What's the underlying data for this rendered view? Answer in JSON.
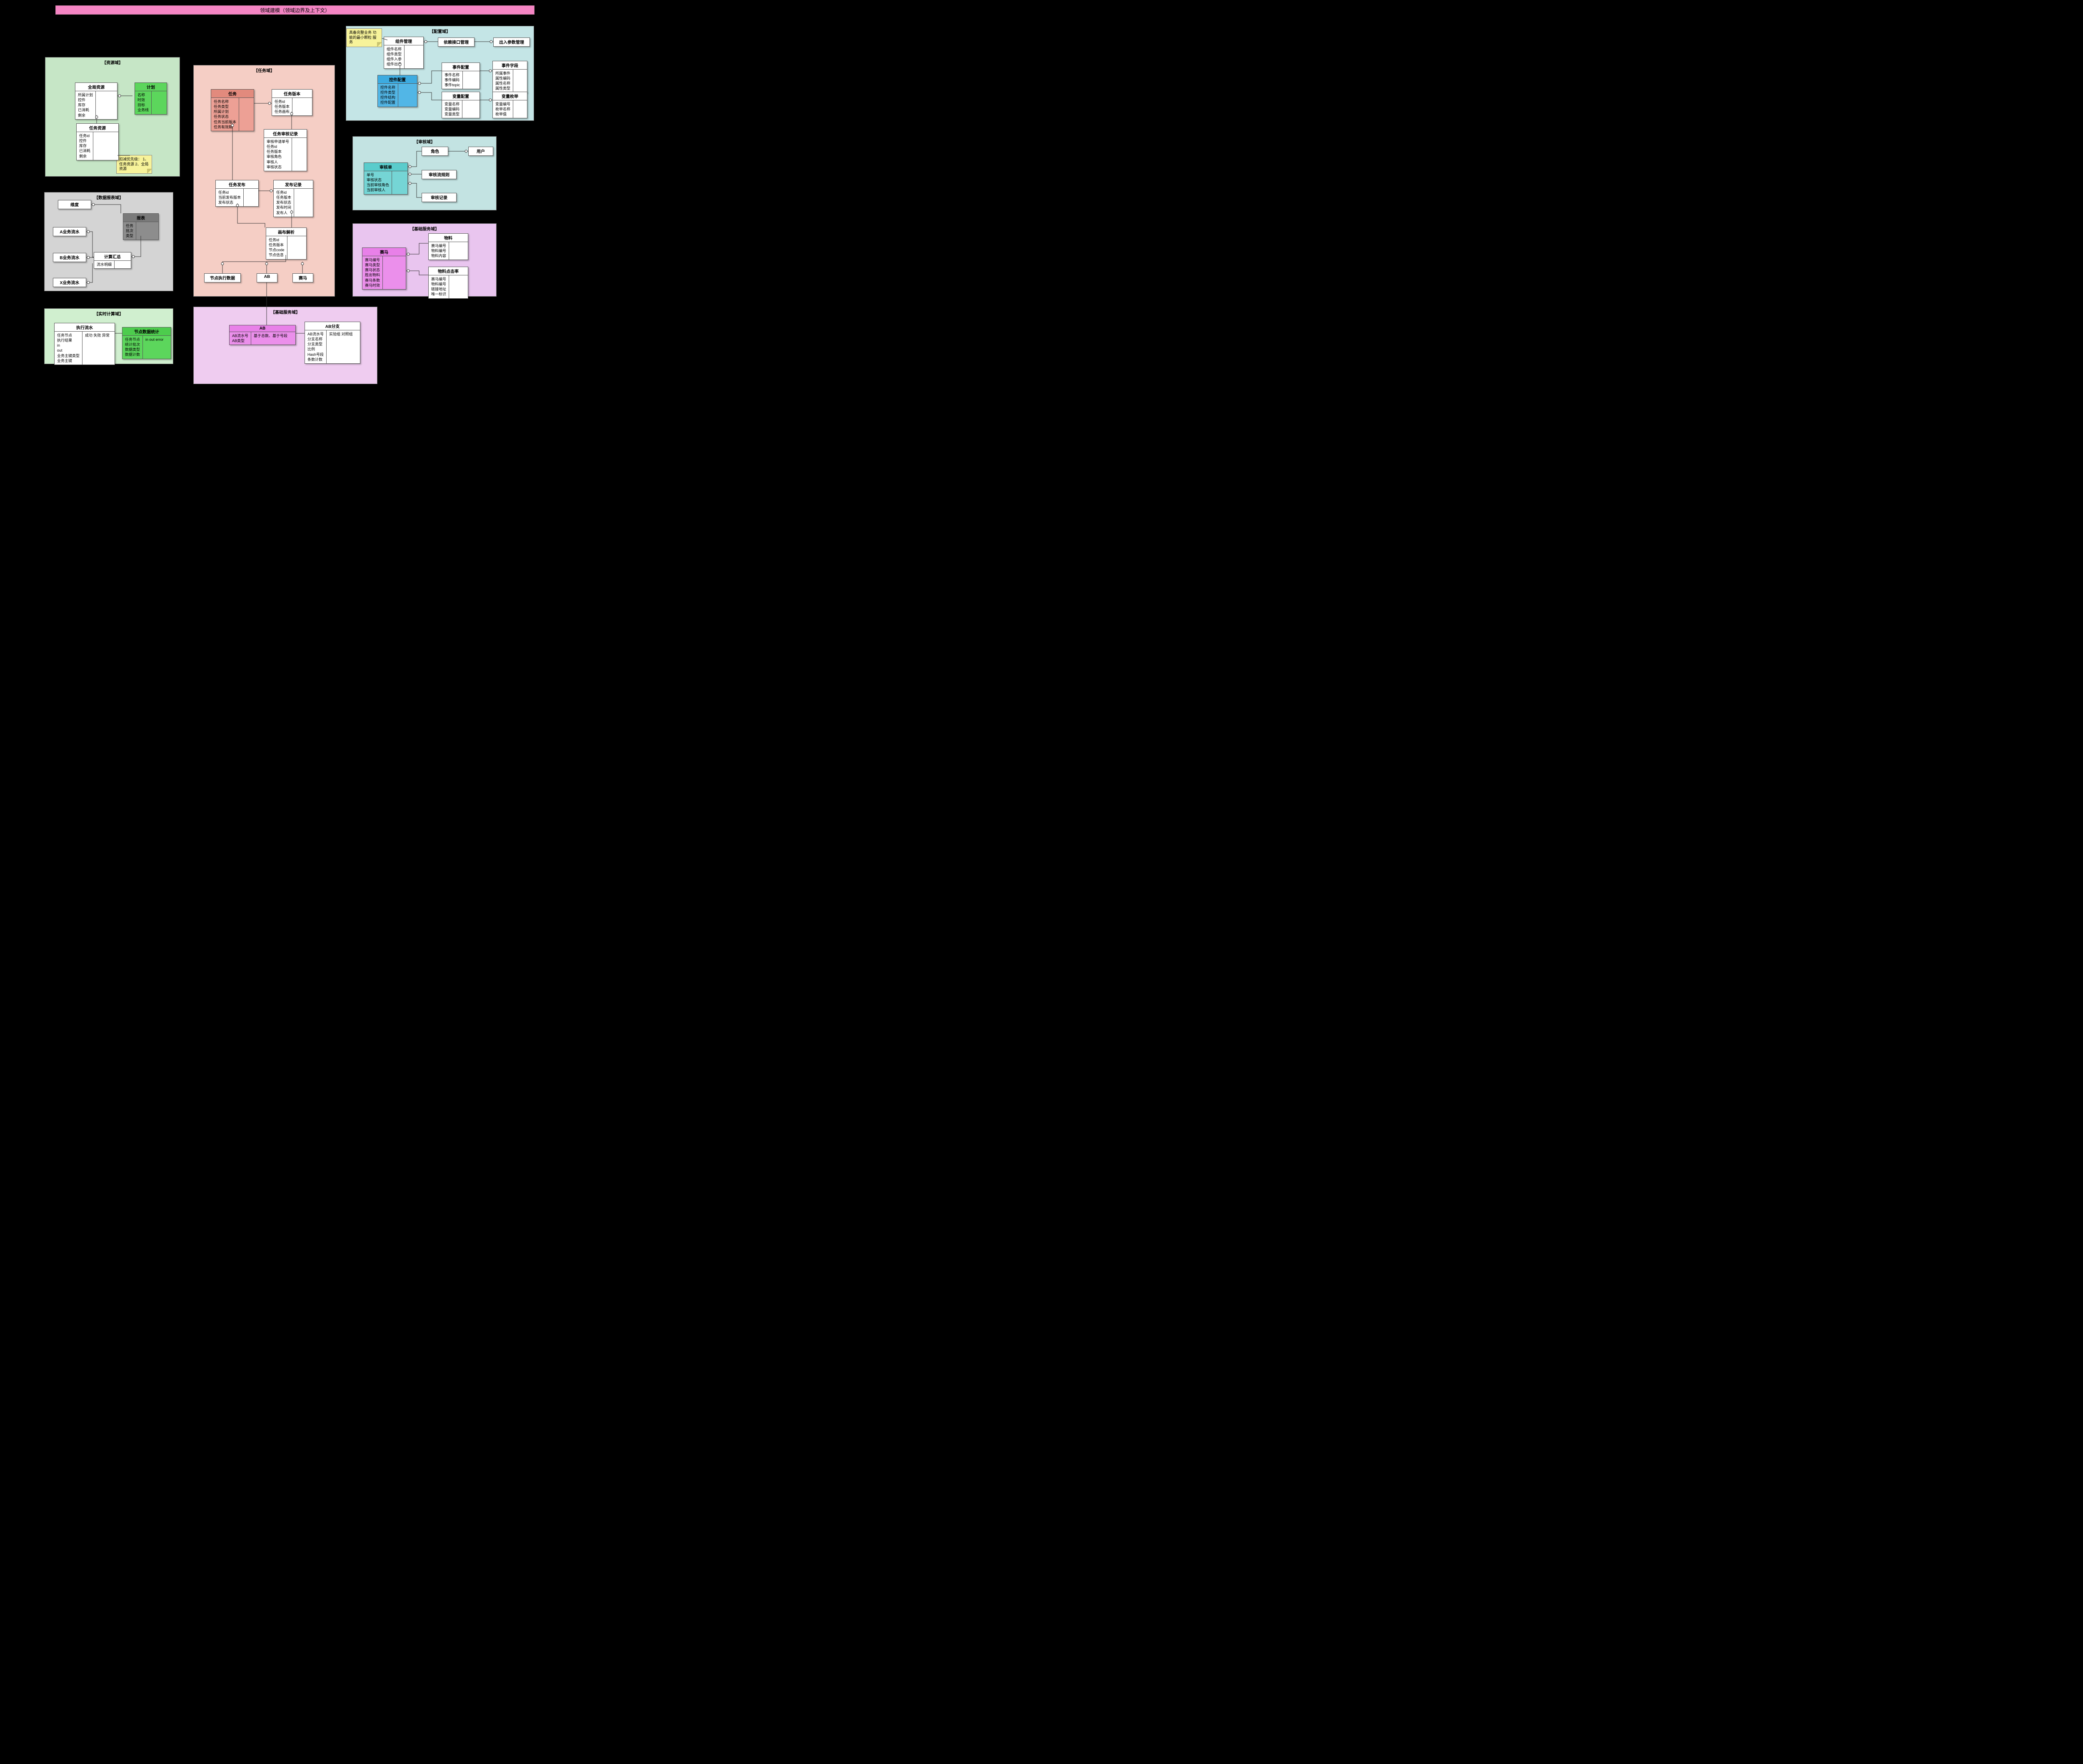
{
  "banner": "领域建模（领域边界及上下文）",
  "notes": {
    "n1": "具备完整业务\n功能的最小颗粒\n服务",
    "n2": "扣减优先级：\n1、任务资源\n2、全局资源"
  },
  "domains": {
    "res": {
      "title": "【资源域】"
    },
    "data": {
      "title": "【数据报表域】"
    },
    "rt": {
      "title": "【实时计算域】"
    },
    "task": {
      "title": "【任务域】"
    },
    "base": {
      "title": "【基础服务域】"
    },
    "conf": {
      "title": "【配置域】"
    },
    "audit": {
      "title": "【审核域】"
    },
    "basic": {
      "title": "【基础服务域】"
    }
  },
  "entities": {
    "global_res": {
      "name": "全局资源",
      "attrs": [
        "所属计划",
        "控件",
        "库存",
        "已消耗",
        "剩余"
      ]
    },
    "plan": {
      "name": "计划",
      "attrs": [
        "名称",
        "时效",
        "目标",
        "业务线"
      ]
    },
    "task_res": {
      "name": "任务资源",
      "attrs": [
        "任务id",
        "控件",
        "库存",
        "已消耗",
        "剩余"
      ]
    },
    "dim": {
      "name": "维度",
      "attrs": []
    },
    "report": {
      "name": "报表",
      "attrs": [
        "任务",
        "批次",
        "类型"
      ]
    },
    "flowA": {
      "name": "A业务流水",
      "attrs": []
    },
    "flowB": {
      "name": "B业务流水",
      "attrs": []
    },
    "flowX": {
      "name": "X业务流水",
      "attrs": []
    },
    "calc": {
      "name": "计算汇总",
      "attrs": [
        "流水明细"
      ]
    },
    "exec_flow": {
      "name": "执行流水",
      "attrs": [
        "任务节点",
        "执行结果",
        "in",
        "out",
        "业务主键类型",
        "业务主键"
      ],
      "side": "成功 失败 异常"
    },
    "node_stat": {
      "name": "节点数据统计",
      "attrs": [
        "任务节点",
        "统计批次",
        "数据类型",
        "数据计数"
      ],
      "side": "in out error"
    },
    "task": {
      "name": "任务",
      "attrs": [
        "任务名称",
        "任务类型",
        "所属计划",
        "任务状态",
        "任务当前版本",
        "任务有效期"
      ]
    },
    "task_ver": {
      "name": "任务版本",
      "attrs": [
        "任务id",
        "任务版本",
        "任务画布"
      ]
    },
    "task_review": {
      "name": "任务审核记录",
      "attrs": [
        "审核申请单号",
        "任务id",
        "任务版本",
        "审核角色",
        "审核人",
        "审核状态"
      ]
    },
    "task_pub": {
      "name": "任务发布",
      "attrs": [
        "任务id",
        "当前发布版本",
        "发布状态"
      ]
    },
    "pub_rec": {
      "name": "发布记录",
      "attrs": [
        "任务id",
        "任务版本",
        "发布状态",
        "发布时间",
        "发布人"
      ]
    },
    "canvas": {
      "name": "画布解析",
      "attrs": [
        "任务id",
        "任务版本",
        "节点code",
        "节点信息"
      ]
    },
    "node_exec": {
      "name": "节点执行数据",
      "attrs": []
    },
    "ab": {
      "name": "AB",
      "attrs": []
    },
    "horse": {
      "name": "赛马",
      "attrs": []
    },
    "ab_main": {
      "name": "AB",
      "attrs": [
        "AB流水号",
        "AB类型"
      ],
      "side": "基于总数、基于号段"
    },
    "ab_branch": {
      "name": "AB分支",
      "attrs": [
        "AB流水号",
        "分支名称",
        "分支类型",
        "比例",
        "Hash号段",
        "条数计数"
      ],
      "side": "实验组 对照组"
    },
    "comp": {
      "name": "组件管理",
      "attrs": [
        "组件名称",
        "组件类型",
        "组件入参",
        "组件出参"
      ]
    },
    "dep": {
      "name": "依赖接口管理",
      "attrs": []
    },
    "io": {
      "name": "出入参数管理",
      "attrs": []
    },
    "ctrl": {
      "name": "控件配置",
      "attrs": [
        "控件名称",
        "控件类型",
        "控件结构",
        "控件配置"
      ]
    },
    "evt": {
      "name": "事件配置",
      "attrs": [
        "事件名称",
        "事件编码",
        "事件topic"
      ]
    },
    "evt_field": {
      "name": "事件字段",
      "attrs": [
        "所属事件",
        "属性编码",
        "属性名称",
        "属性类型"
      ]
    },
    "var": {
      "name": "变量配置",
      "attrs": [
        "变量名称",
        "变量编码",
        "变量类型"
      ]
    },
    "var_enum": {
      "name": "变量枚举",
      "attrs": [
        "变量编号",
        "枚举名称",
        "枚举值"
      ]
    },
    "role": {
      "name": "角色",
      "attrs": []
    },
    "user": {
      "name": "用户",
      "attrs": []
    },
    "review": {
      "name": "审核单",
      "attrs": [
        "单号",
        "审核状态",
        "当前审核角色",
        "当前审核人"
      ]
    },
    "rule": {
      "name": "审核流规则",
      "attrs": []
    },
    "rev_rec": {
      "name": "审核记录",
      "attrs": []
    },
    "race": {
      "name": "赛马",
      "attrs": [
        "赛马编号",
        "赛马类型",
        "赛马状态",
        "胜出物料",
        "赛马条数",
        "赛马时效"
      ]
    },
    "material": {
      "name": "物料",
      "attrs": [
        "赛马编号",
        "物料编号",
        "物料内容"
      ]
    },
    "ctr": {
      "name": "物料点击率",
      "attrs": [
        "赛马编号",
        "物料编号",
        "链接地址",
        "唯一标识"
      ]
    }
  }
}
